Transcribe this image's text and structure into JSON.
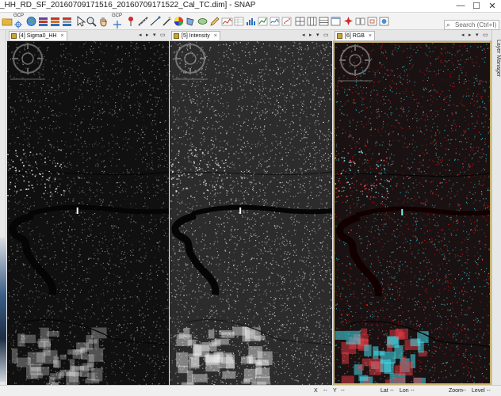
{
  "window": {
    "title": "_HH_RD_SF_20160709171516_20160709171522_Cal_TC.dim] - SNAP",
    "minimize": "—",
    "maximize": "☐",
    "close": "✕"
  },
  "toolbar": {
    "gcp_label_1": "GCP",
    "gcp_label_2": "GCP",
    "search_placeholder": "Search (Ctrl+I)"
  },
  "panels": [
    {
      "tab_label": "[4] Sigma0_HH",
      "image_style": "sigma"
    },
    {
      "tab_label": "[5] Intensity",
      "image_style": "intensity"
    },
    {
      "tab_label": "[6] RGB",
      "image_style": "rgb"
    }
  ],
  "right_tab": {
    "label": "Layer Manager"
  },
  "panel_nav": {
    "prev": "◂",
    "next": "▸",
    "menu": "▾",
    "restore": "▭"
  },
  "statusbar": {
    "x_label": "X",
    "x_sep": "--",
    "y_label": "Y",
    "y_sep": "--",
    "lat_label": "Lat",
    "lat_sep": "--",
    "lon_label": "Lon",
    "lon_sep": "--",
    "zoom_label": "Zoom",
    "zoom_sep": "--",
    "level_label": "Level",
    "level_sep": "--"
  }
}
